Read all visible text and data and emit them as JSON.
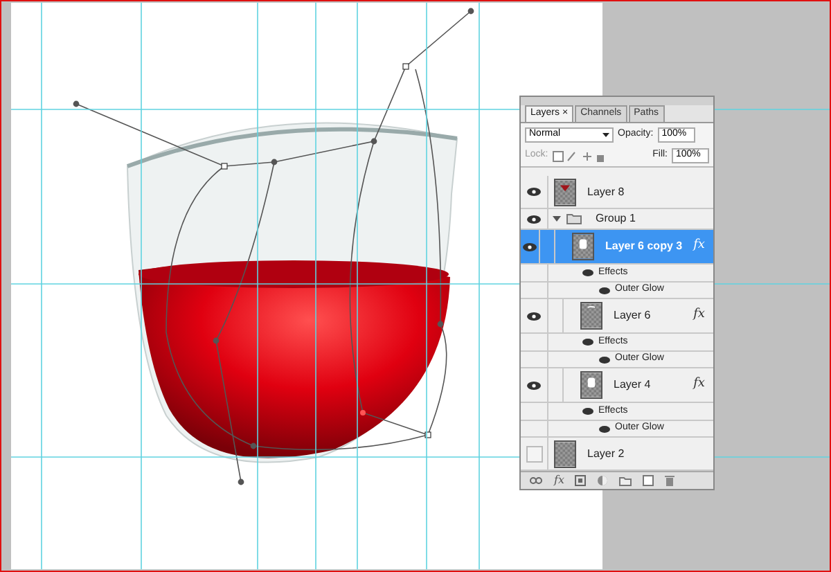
{
  "tabs": [
    {
      "label": "Layers",
      "selected": true,
      "close": "×"
    },
    {
      "label": "Channels",
      "selected": false
    },
    {
      "label": "Paths",
      "selected": false
    }
  ],
  "blend_mode": "Normal",
  "opacity": {
    "label": "Opacity:",
    "value": "100%"
  },
  "lock": {
    "label": "Lock:"
  },
  "fill": {
    "label": "Fill:",
    "value": "100%"
  },
  "layers": [
    {
      "kind": "layer",
      "name": "Layer 8",
      "visible": true,
      "selected": false,
      "thumb": {
        "kind": "red"
      }
    },
    {
      "kind": "group",
      "name": "Group 1",
      "visible": true,
      "expanded": true,
      "children": [
        {
          "kind": "layer",
          "name": "Layer 6 copy 3",
          "visible": true,
          "selected": true,
          "thumb": {
            "kind": "white"
          },
          "fx": "fx",
          "effects": {
            "label": "Effects",
            "items": [
              "Outer Glow"
            ]
          }
        },
        {
          "kind": "layer",
          "name": "Layer 6",
          "visible": true,
          "selected": false,
          "thumb": {
            "kind": "streak"
          },
          "fx": "fx",
          "effects": {
            "label": "Effects",
            "items": [
              "Outer Glow"
            ]
          }
        },
        {
          "kind": "layer",
          "name": "Layer 4",
          "visible": true,
          "selected": false,
          "thumb": {
            "kind": "white"
          },
          "fx": "fx",
          "effects": {
            "label": "Effects",
            "items": [
              "Outer Glow"
            ]
          }
        }
      ]
    },
    {
      "kind": "layer",
      "name": "Layer 2",
      "visible": false,
      "selected": false,
      "thumb": {
        "kind": "plain"
      }
    }
  ],
  "footer_fx": "fx"
}
